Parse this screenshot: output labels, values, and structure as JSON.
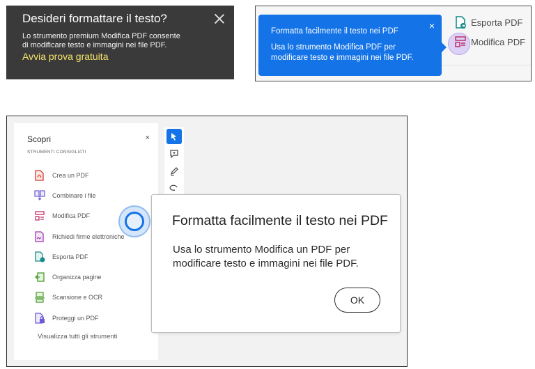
{
  "dark_toast": {
    "title": "Desideri formattare il testo?",
    "body": "Lo strumento premium Modifica PDF consente di modificare testo e immagini nei file PDF.",
    "link": "Avvia prova gratuita"
  },
  "coachmark": {
    "title": "Formatta facilmente il testo nei PDF",
    "body": "Usa lo strumento Modifica PDF per modificare testo e immagini nei file PDF.",
    "close": "×"
  },
  "tools_panel": {
    "export_label": "Esporta PDF",
    "modify_label": "Modifica PDF"
  },
  "sidebar": {
    "title": "Scopri",
    "close": "×",
    "section": "STRUMENTI CONSIGLIATI",
    "items": [
      {
        "label": "Crea un PDF",
        "icon": "create-pdf-icon",
        "color": "#d9352c"
      },
      {
        "label": "Combinare i file",
        "icon": "combine-files-icon",
        "color": "#6b5bd6"
      },
      {
        "label": "Modifica PDF",
        "icon": "edit-pdf-icon",
        "color": "#d9352c"
      },
      {
        "label": "Richiedi firme elettroniche",
        "icon": "request-signature-icon",
        "color": "#a13ab0"
      },
      {
        "label": "Esporta PDF",
        "icon": "export-pdf-icon",
        "color": "#1a8a8a"
      },
      {
        "label": "Organizza pagine",
        "icon": "organize-pages-icon",
        "color": "#4a9b2e"
      },
      {
        "label": "Scansione e OCR",
        "icon": "scan-ocr-icon",
        "color": "#4a9b2e"
      },
      {
        "label": "Proteggi un PDF",
        "icon": "protect-pdf-icon",
        "color": "#6b5bd6"
      }
    ],
    "view_all": "Visualizza tutti gli strumenti"
  },
  "dialog": {
    "title": "Formatta facilmente il testo nei PDF",
    "body": "Usa lo strumento Modifica un PDF per modificare testo e immagini nei file PDF.",
    "ok": "OK"
  },
  "colors": {
    "accent": "#1473e6",
    "toast_bg": "#3a3a3a",
    "link_yellow": "#f5e36a"
  }
}
